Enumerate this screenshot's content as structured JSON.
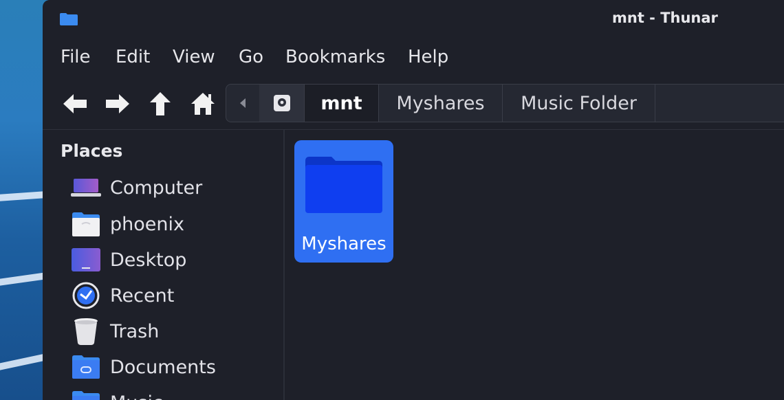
{
  "window": {
    "title": "mnt - Thunar",
    "app_icon": "folder-icon"
  },
  "menu": [
    "File",
    "Edit",
    "View",
    "Go",
    "Bookmarks",
    "Help"
  ],
  "toolbar": {
    "back_icon": "arrow-left-icon",
    "forward_icon": "arrow-right-icon",
    "up_icon": "arrow-up-icon",
    "home_icon": "home-icon"
  },
  "pathbar": {
    "crumbs": [
      "mnt",
      "Myshares",
      "Music Folder"
    ],
    "active": "mnt",
    "drive_icon": "drive-icon"
  },
  "sidebar": {
    "section": "Places",
    "items": [
      {
        "label": "Computer",
        "icon": "computer-icon"
      },
      {
        "label": "phoenix",
        "icon": "home-folder-icon"
      },
      {
        "label": "Desktop",
        "icon": "desktop-icon"
      },
      {
        "label": "Recent",
        "icon": "clock-icon"
      },
      {
        "label": "Trash",
        "icon": "trash-icon"
      },
      {
        "label": "Documents",
        "icon": "documents-folder-icon"
      },
      {
        "label": "Music",
        "icon": "music-folder-icon"
      }
    ]
  },
  "content": {
    "files": [
      {
        "name": "Myshares",
        "type": "folder",
        "selected": true
      }
    ]
  },
  "colors": {
    "accent": "#2f6ff2",
    "folder": "#0f3ef0",
    "window_bg": "#1e2029"
  }
}
